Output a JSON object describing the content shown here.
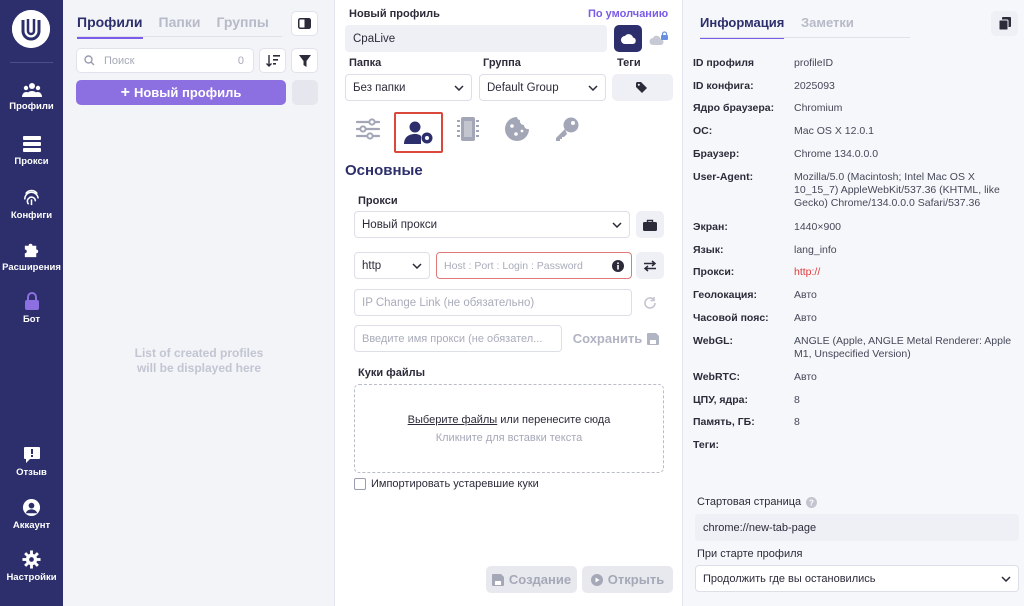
{
  "nav": {
    "items": [
      {
        "label": "Профили",
        "icon": "users-icon"
      },
      {
        "label": "Прокси",
        "icon": "server-icon"
      },
      {
        "label": "Конфиги",
        "icon": "fingerprint-icon"
      },
      {
        "label": "Расширения",
        "icon": "puzzle-icon"
      },
      {
        "label": "Бот",
        "icon": "lock-icon"
      },
      {
        "label": "Отзыв",
        "icon": "feedback-icon"
      },
      {
        "label": "Аккаунт",
        "icon": "account-icon"
      },
      {
        "label": "Настройки",
        "icon": "gear-icon"
      }
    ]
  },
  "profiles": {
    "tabs": [
      "Профили",
      "Папки",
      "Группы"
    ],
    "search_placeholder": "Поиск",
    "count": "0",
    "new_button": "Новый профиль",
    "empty_line1": "List of created profiles",
    "empty_line2": "will be displayed here"
  },
  "form": {
    "title_label": "Новый профиль",
    "default_link": "По умолчанию",
    "name_value": "CpaLive",
    "folder_label": "Папка",
    "folder_value": "Без папки",
    "group_label": "Группа",
    "group_value": "Default Group",
    "tags_label": "Теги",
    "section_title": "Основные",
    "proxy_label": "Прокси",
    "proxy_value": "Новый прокси",
    "protocol_value": "http",
    "host_placeholder": "Host : Port : Login : Password",
    "ip_change_placeholder": "IP Change Link (не обязательно)",
    "proxy_name_placeholder": "Введите имя прокси (не обязател...",
    "save_label": "Сохранить",
    "cookies_label": "Куки файлы",
    "choose_files": "Выберите файлы",
    "drop_text": "или перенесите сюда",
    "paste_text": "Кликните для вставки текста",
    "import_old_cookies": "Импортировать устаревшие куки",
    "create_label": "Создание",
    "open_label": "Открыть"
  },
  "info": {
    "tabs": [
      "Информация",
      "Заметки"
    ],
    "rows": [
      {
        "k": "ID профиля",
        "v": "profileID"
      },
      {
        "k": "ID конфига:",
        "v": "2025093"
      },
      {
        "k": "Ядро браузера:",
        "v": "Chromium"
      },
      {
        "k": "ОС:",
        "v": "Mac OS X 12.0.1"
      },
      {
        "k": "Браузер:",
        "v": "Chrome 134.0.0.0"
      },
      {
        "k": "User-Agent:",
        "v": "Mozilla/5.0 (Macintosh; Intel Mac OS X 10_15_7) AppleWebKit/537.36 (KHTML, like Gecko) Chrome/134.0.0.0 Safari/537.36"
      },
      {
        "k": "Экран:",
        "v": "1440×900"
      },
      {
        "k": "Язык:",
        "v": "lang_info"
      },
      {
        "k": "Прокси:",
        "v": "http://"
      },
      {
        "k": "Геолокация:",
        "v": "Авто"
      },
      {
        "k": "Часовой пояс:",
        "v": "Авто"
      },
      {
        "k": "WebGL:",
        "v": "ANGLE (Apple, ANGLE Metal Renderer: Apple M1, Unspecified Version)"
      },
      {
        "k": "WebRTC:",
        "v": "Авто"
      },
      {
        "k": "ЦПУ, ядра:",
        "v": "8"
      },
      {
        "k": "Память, ГБ:",
        "v": "8"
      },
      {
        "k": "Теги:",
        "v": ""
      }
    ],
    "start_page_label": "Стартовая страница",
    "start_page_value": "chrome://new-tab-page",
    "on_start_label": "При старте профиля",
    "on_start_value": "Продолжить где вы остановились"
  },
  "colors": {
    "nav": "#2c2f6b",
    "accent": "#8c6fe0",
    "proxy_red": "#e03a3a",
    "highlight": "#d9483b"
  }
}
